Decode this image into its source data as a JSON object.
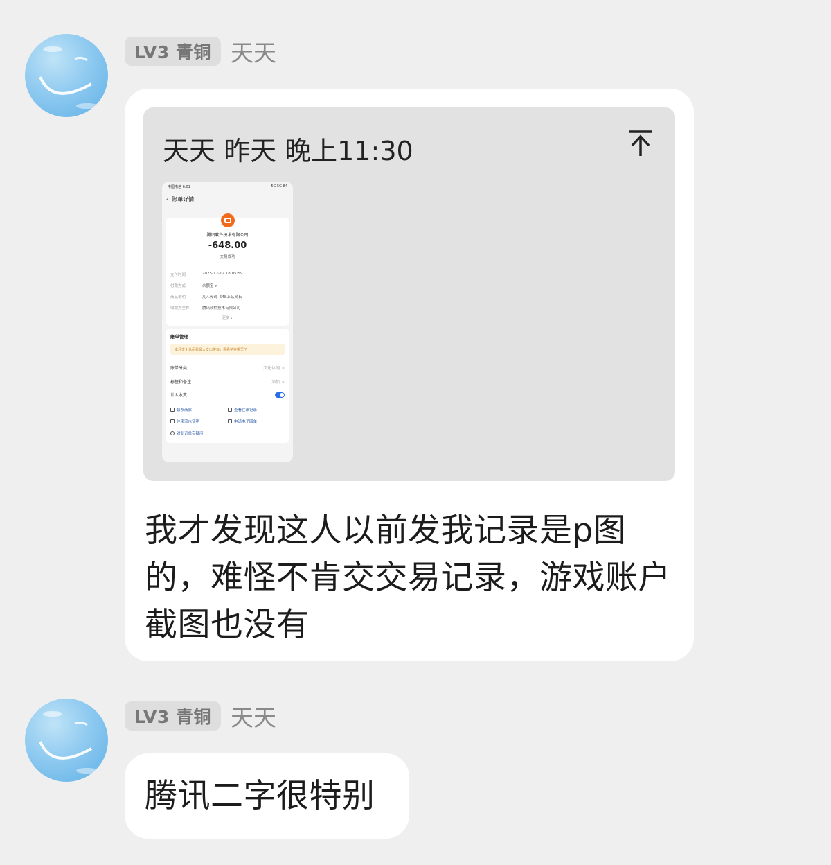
{
  "messages": [
    {
      "sender": {
        "level": "LV3 青铜",
        "name": "天天"
      },
      "forward": {
        "title": "天天 昨天 晚上11:30",
        "screenshot": {
          "status_left": "中国电信 6:01",
          "status_right": "5G 5G 84",
          "nav_title": "账单详情",
          "merchant": "腾讯软件技术有限公司",
          "amount": "-648.00",
          "status": "交易成功",
          "rows": [
            {
              "k": "支付时间",
              "v": "2025-12-12 18:05:59"
            },
            {
              "k": "付款方式",
              "v": "余额宝 >"
            },
            {
              "k": "商品说明",
              "v": "凡人传说_648上品灵石"
            },
            {
              "k": "收款方全称",
              "v": "腾讯软件技术有限公司"
            }
          ],
          "more": "更多 ∨",
          "manage_title": "账单管理",
          "tip": "本月文化休闲是最大支出类目，看看花在哪里了",
          "category_label": "账单分类",
          "category_value": "文化休闲 >",
          "tags_label": "标签和备注",
          "tags_value": "添加 >",
          "count_label": "计入收支",
          "links": {
            "contact": "联系商家",
            "history": "查看往来记录",
            "flow": "往来流水证明",
            "receipt": "申请电子回单",
            "question": "对此订单有疑问"
          }
        }
      },
      "text": "我才发现这人以前发我记录是p图的，难怪不肯交交易记录，游戏账户截图也没有"
    },
    {
      "sender": {
        "level": "LV3 青铜",
        "name": "天天"
      },
      "text": "腾讯二字很特别"
    }
  ],
  "colors": {
    "background": "#efefef",
    "bubble": "#ffffff",
    "badge": "#dedede",
    "toggle_on": "#2a6ee6",
    "merchant_logo": "#f06b1c"
  },
  "icons": {
    "collapse": "arrow-up-to-line-icon",
    "back": "chevron-left-icon"
  }
}
